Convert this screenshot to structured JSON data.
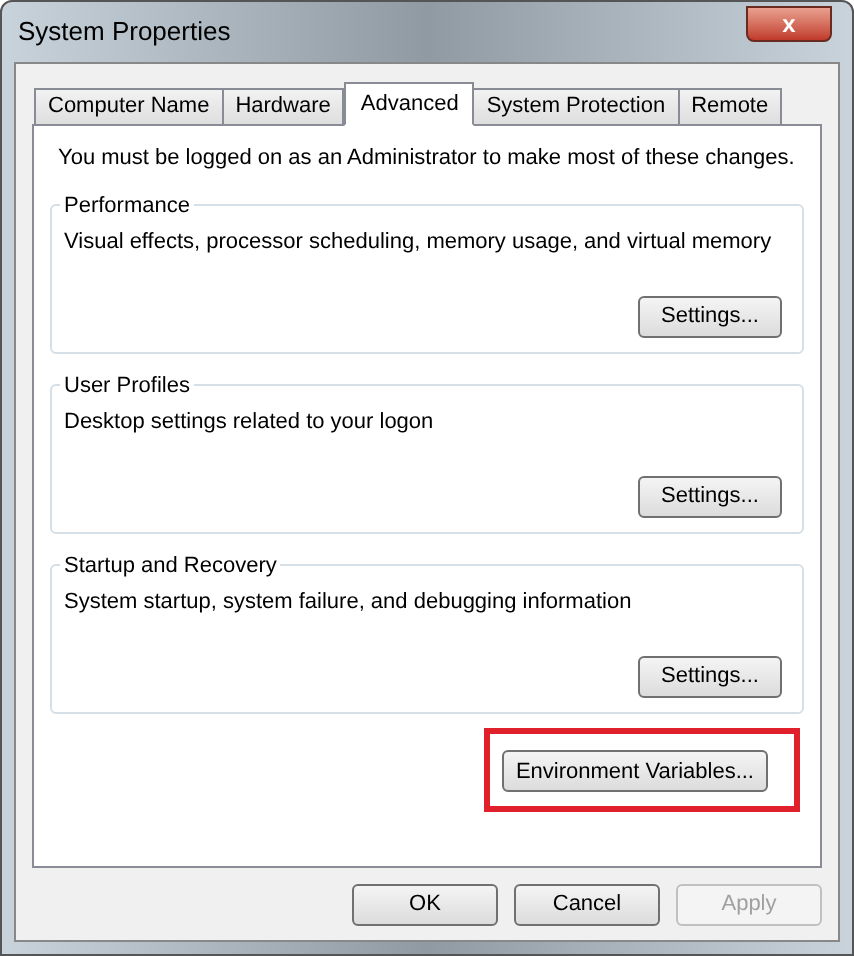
{
  "window": {
    "title": "System Properties",
    "close": "x"
  },
  "tabs": [
    {
      "label": "Computer Name",
      "selected": false
    },
    {
      "label": "Hardware",
      "selected": false
    },
    {
      "label": "Advanced",
      "selected": true
    },
    {
      "label": "System Protection",
      "selected": false
    },
    {
      "label": "Remote",
      "selected": false
    }
  ],
  "notice": "You must be logged on as an Administrator to make most of these changes.",
  "groups": [
    {
      "title": "Performance",
      "description": "Visual effects, processor scheduling, memory usage, and virtual memory",
      "button": "Settings..."
    },
    {
      "title": "User Profiles",
      "description": "Desktop settings related to your logon",
      "button": "Settings..."
    },
    {
      "title": "Startup and Recovery",
      "description": "System startup, system failure, and debugging information",
      "button": "Settings..."
    }
  ],
  "environment_button": {
    "label": "Environment Variables...",
    "highlighted": true
  },
  "buttons": [
    {
      "label": "OK",
      "disabled": false
    },
    {
      "label": "Cancel",
      "disabled": false
    },
    {
      "label": "Apply",
      "disabled": true
    }
  ]
}
